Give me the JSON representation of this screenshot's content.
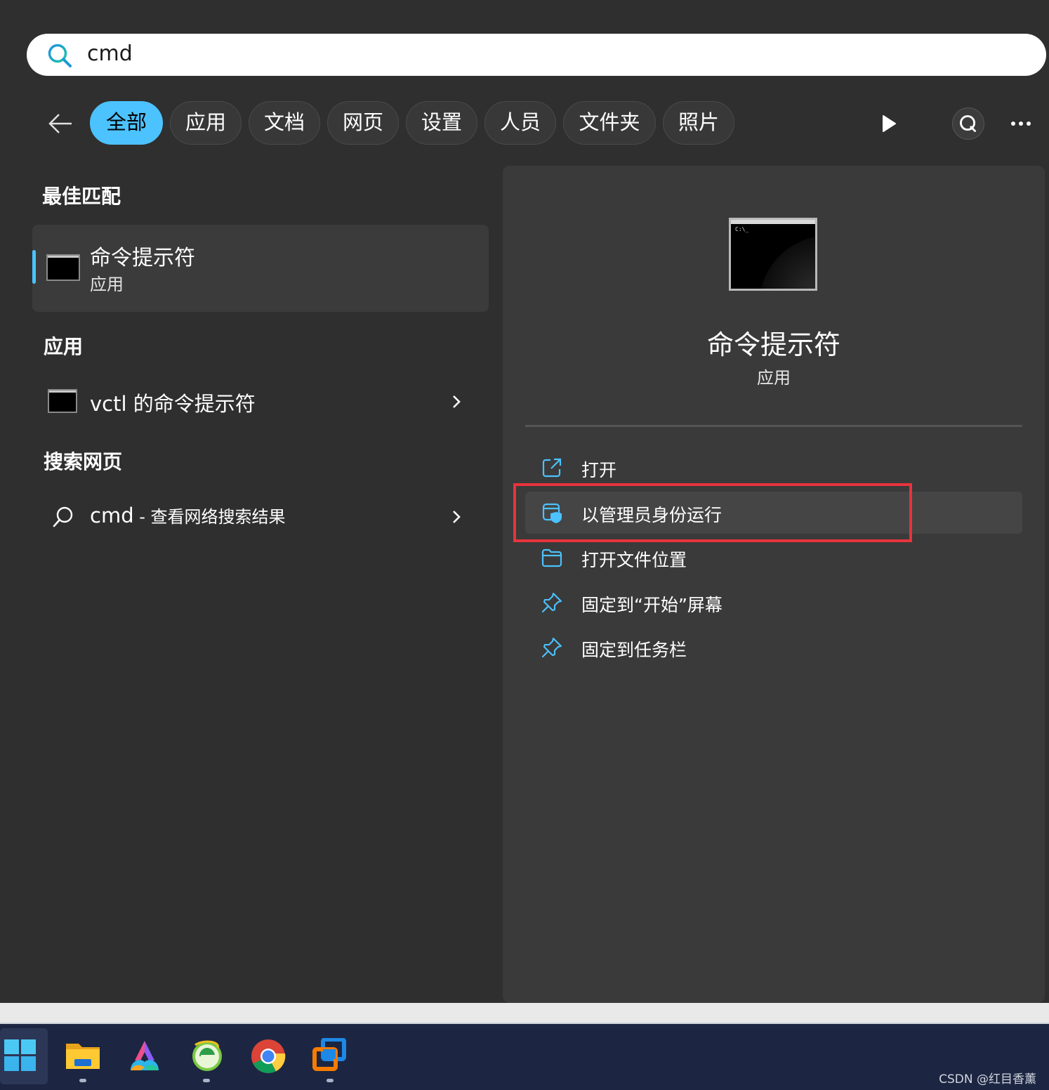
{
  "search": {
    "query": "cmd"
  },
  "filters": [
    "全部",
    "应用",
    "文档",
    "网页",
    "设置",
    "人员",
    "文件夹",
    "照片"
  ],
  "active_filter": "全部",
  "sections": {
    "best_match": "最佳匹配",
    "apps": "应用",
    "web": "搜索网页"
  },
  "best_match_item": {
    "title": "命令提示符",
    "subtitle": "应用"
  },
  "app_items": [
    {
      "title": "vctl 的命令提示符"
    }
  ],
  "web_item": {
    "query": "cmd",
    "separator": " - ",
    "suffix": "查看网络搜索结果"
  },
  "detail": {
    "title": "命令提示符",
    "subtitle": "应用",
    "icon_prompt": "C:\\_",
    "actions": [
      {
        "label": "打开",
        "icon": "open-external-icon"
      },
      {
        "label": "以管理员身份运行",
        "icon": "shield-admin-icon"
      },
      {
        "label": "打开文件位置",
        "icon": "folder-icon"
      },
      {
        "label": "固定到“开始”屏幕",
        "icon": "pin-icon"
      },
      {
        "label": "固定到任务栏",
        "icon": "pin-icon"
      }
    ],
    "highlighted_action": "以管理员身份运行"
  },
  "taskbar": {
    "apps": [
      "start-icon",
      "file-explorer-icon",
      "app-a-icon",
      "ie-icon",
      "chrome-icon",
      "vmware-icon"
    ]
  },
  "watermark": "CSDN @红目香薰",
  "colors": {
    "accent": "#4cc2ff",
    "highlight_box": "#e8333c",
    "taskbar": "#1c2642"
  }
}
